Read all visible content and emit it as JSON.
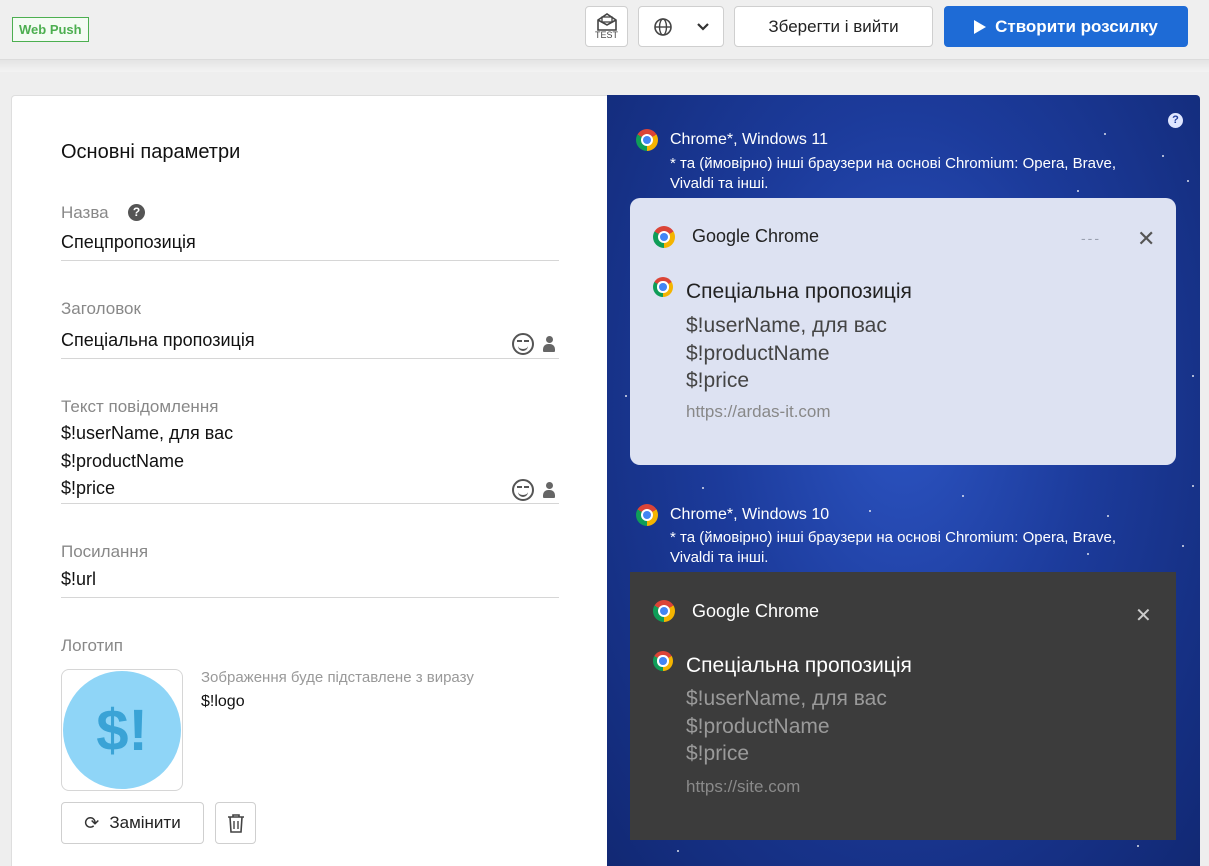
{
  "header": {
    "badge": "Web Push",
    "test_label": "TEST",
    "save_label": "Зберегти і вийти",
    "create_label": "Створити розсилку"
  },
  "form": {
    "section_title": "Основні параметри",
    "name": {
      "label": "Назва",
      "value": "Спецпропозиція"
    },
    "title": {
      "label": "Заголовок",
      "value": "Спеціальна пропозиція"
    },
    "message": {
      "label": "Текст повідомлення",
      "lines": [
        "$!userName, для вас",
        "$!productName",
        "$!price"
      ]
    },
    "link": {
      "label": "Посилання",
      "value": "$!url"
    },
    "logo": {
      "label": "Логотип",
      "placeholder_text": "$!",
      "note": "Зображення буде підставлене з виразу",
      "expression": "$!logo",
      "replace_label": "Замінити"
    }
  },
  "preview": {
    "win11": {
      "os_title": "Chrome*, Windows 11",
      "note": "* та (ймовірно) інші браузери на основі Chromium: Opera, Brave, Vivaldi та інші.",
      "app": "Google Chrome",
      "dots": "---",
      "close": "✕",
      "title": "Спеціальна пропозиція",
      "body": [
        "$!userName, для вас",
        "$!productName",
        "$!price"
      ],
      "url": "https://ardas-it.com"
    },
    "win10": {
      "os_title": "Chrome*, Windows 10",
      "note": "* та (ймовірно) інші браузери на основі Chromium: Opera, Brave, Vivaldi та інші.",
      "app": "Google Chrome",
      "close": "✕",
      "title": "Спеціальна пропозиція",
      "body": [
        "$!userName, для вас",
        "$!productName",
        "$!price"
      ],
      "url": "https://site.com"
    }
  },
  "colors": {
    "accent": "#1e6bd6",
    "badge_green": "#4caf50",
    "preview_bg": "#1c3b9b",
    "card_light": "#dde2f2",
    "card_dark": "#3c3c3c"
  },
  "icons": [
    "test-email-icon",
    "globe-icon",
    "chevron-down-icon",
    "play-icon",
    "help-icon",
    "emoji-icon",
    "user-variable-icon",
    "refresh-icon",
    "trash-icon",
    "chrome-icon",
    "close-icon"
  ]
}
